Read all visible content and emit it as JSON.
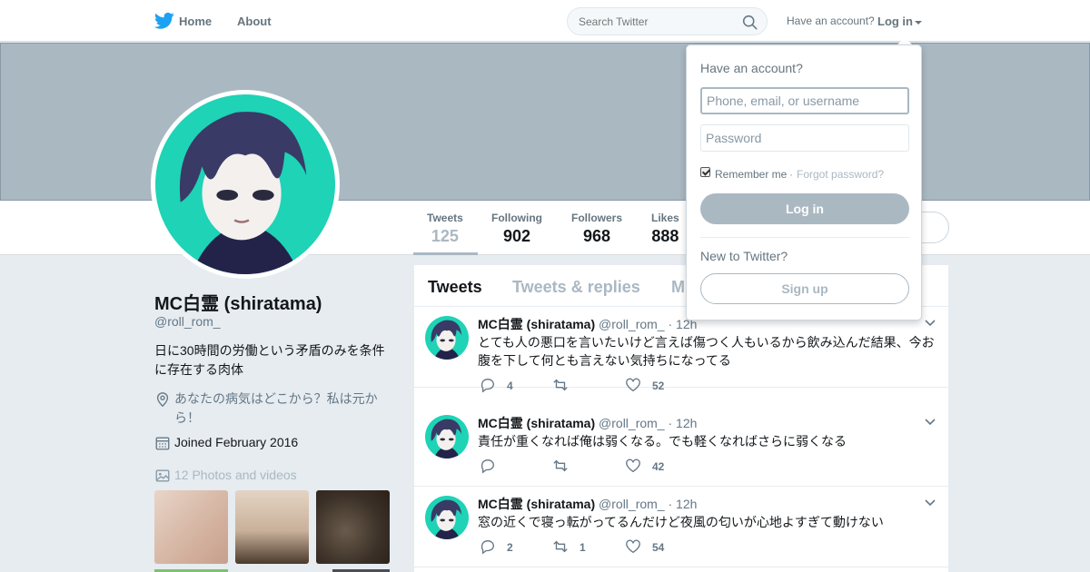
{
  "nav": {
    "logo_icon": "twitter-bird-icon",
    "home_label": "Home",
    "about_label": "About",
    "search_placeholder": "Search Twitter",
    "have_account": "Have an account?",
    "login_label": "Log in"
  },
  "profile": {
    "name": "MC白霊 (shiratama)",
    "handle": "@roll_rom_",
    "bio": "日に30時間の労働という矛盾のみを条件に存在する肉体",
    "location": "あなたの病気はどこから？私は元から！",
    "joined": "Joined February 2016",
    "photos": "12 Photos and videos"
  },
  "stats": [
    {
      "label": "Tweets",
      "value": "125"
    },
    {
      "label": "Following",
      "value": "902"
    },
    {
      "label": "Followers",
      "value": "968"
    },
    {
      "label": "Likes",
      "value": "888"
    }
  ],
  "tabs": [
    "Tweets",
    "Tweets & replies",
    "M"
  ],
  "tweets": [
    {
      "name": "MC白霊 (shiratama)",
      "handle": "@roll_rom_",
      "time": "· 12h",
      "text": "とても人の悪口を言いたいけど言えば傷つく人もいるから飲み込んだ結果、今お腹を下して何とも言えない気持ちになってる",
      "replies": "4",
      "retweets": "",
      "likes": "52"
    },
    {
      "name": "MC白霊 (shiratama)",
      "handle": "@roll_rom_",
      "time": "· 12h",
      "text": "責任が重くなれば俺は弱くなる。でも軽くなればさらに弱くなる",
      "replies": "",
      "retweets": "",
      "likes": "42"
    },
    {
      "name": "MC白霊 (shiratama)",
      "handle": "@roll_rom_",
      "time": "· 12h",
      "text": "窓の近くで寝っ転がってるんだけど夜風の匂いが心地よすぎて動けない",
      "replies": "2",
      "retweets": "1",
      "likes": "54"
    }
  ],
  "login": {
    "title": "Have an account?",
    "username_placeholder": "Phone, email, or username",
    "password_placeholder": "Password",
    "remember": "Remember me",
    "separator": "·",
    "forgot": "Forgot password?",
    "login_button": "Log in",
    "new_to_twitter": "New to Twitter?",
    "signup_button": "Sign up"
  },
  "colors": {
    "accent": "#aab8c2",
    "brand": "#1da1f2",
    "avatar_bg": "#1ed3b6"
  }
}
